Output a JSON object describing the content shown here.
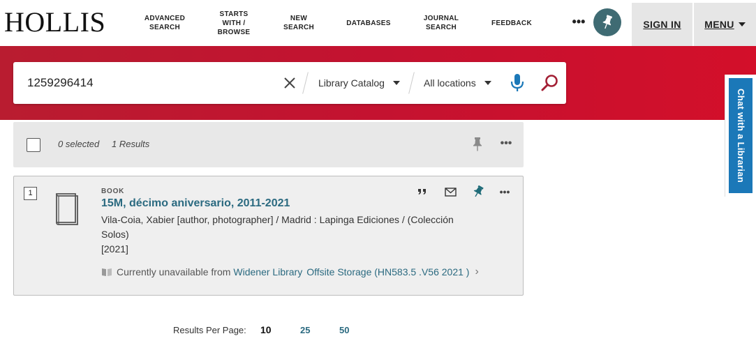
{
  "header": {
    "logo": "HOLLIS",
    "nav": [
      {
        "label": "ADVANCED\nSEARCH",
        "lines": [
          "ADVANCED",
          "SEARCH"
        ]
      },
      {
        "label": "STARTS WITH / BROWSE",
        "lines": [
          "STARTS",
          "WITH /",
          "BROWSE"
        ]
      },
      {
        "label": "NEW SEARCH",
        "lines": [
          "NEW",
          "SEARCH"
        ]
      },
      {
        "label": "DATABASES",
        "lines": [
          "DATABASES"
        ]
      },
      {
        "label": "JOURNAL SEARCH",
        "lines": [
          "JOURNAL",
          "SEARCH"
        ]
      },
      {
        "label": "FEEDBACK",
        "lines": [
          "FEEDBACK"
        ]
      }
    ],
    "more": "•••",
    "sign_in": "SIGN IN",
    "menu": "MENU",
    "pin_color": "#3f6b73"
  },
  "search": {
    "query": "1259296414",
    "scope": "Library Catalog",
    "location": "All locations"
  },
  "chat": {
    "label": "Chat with a Librarian",
    "color": "#1b78b8"
  },
  "results_bar": {
    "selected": "0 selected",
    "count": "1 Results"
  },
  "result": {
    "number": "1",
    "type": "BOOK",
    "title": "15M, décimo aniversario, 2011-2021",
    "details_line1": "Vila-Coia, Xabier [author, photographer] / Madrid : Lapinga Ediciones / (Colección",
    "details_line2": "Solos)",
    "date": "[2021]",
    "availability": "Currently unavailable from",
    "library": "Widener Library",
    "location": "Offsite Storage (HN583.5 .V56 2021 )"
  },
  "pagination": {
    "label": "Results Per Page:",
    "options": [
      "10",
      "25",
      "50"
    ],
    "selected": "10"
  },
  "colors": {
    "brand_red": "#c41230",
    "link_teal": "#2b6a80",
    "search_icon_red": "#a31f34",
    "mic_blue": "#1b78b8"
  }
}
